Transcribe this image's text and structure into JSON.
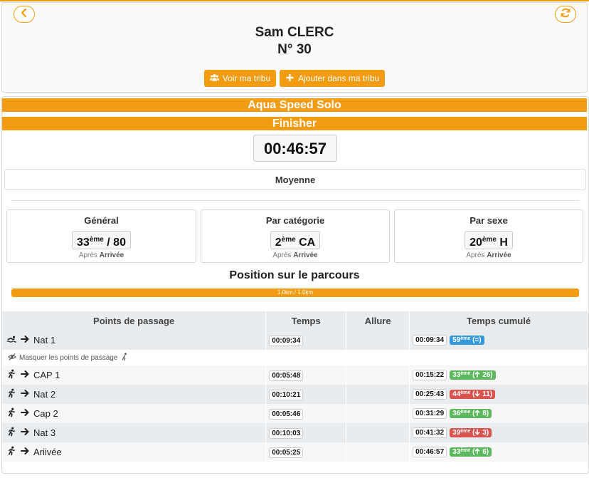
{
  "colors": {
    "accent": "#f39c12",
    "green": "#5cb85c",
    "red": "#d9534f",
    "blue": "#3498db"
  },
  "header": {
    "name": "Sam CLERC",
    "bib": "N° 30",
    "buttons": {
      "view_tribe": "Voir ma tribu",
      "add_tribe": "Ajouter dans ma tribu"
    },
    "icons": {
      "back": "chevron-left-icon",
      "refresh": "refresh-icon",
      "view_tribe": "users-icon",
      "add_tribe": "plus-icon"
    }
  },
  "race": {
    "name": "Aqua Speed Solo",
    "status": "Finisher",
    "total_time": "00:46:57",
    "average_label": "Moyenne"
  },
  "rankings": [
    {
      "title": "Général",
      "num": "33",
      "sup": "ème",
      "suffix": " / 80",
      "after_prefix": "Après",
      "after_point": "Arrivée"
    },
    {
      "title": "Par catégorie",
      "num": "2",
      "sup": "ème",
      "suffix": " CA",
      "after_prefix": "Après",
      "after_point": "Arrivée"
    },
    {
      "title": "Par sexe",
      "num": "20",
      "sup": "ème",
      "suffix": " H",
      "after_prefix": "Après",
      "after_point": "Arrivée"
    }
  ],
  "course": {
    "title": "Position sur le parcours",
    "progress_text": "1.0km / 1.0km",
    "progress_fraction": 1.0
  },
  "table": {
    "headers": [
      "Points de passage",
      "Temps",
      "Allure",
      "Temps cumulé"
    ],
    "hide_text": "Masquer les points de passage",
    "rows": [
      {
        "icon": "swim-icon",
        "label": "Nat 1",
        "time": "00:09:34",
        "cum": "00:09:34",
        "rank": "59",
        "sup": "ème",
        "delta": "(=)",
        "trend": "same",
        "color": "blue"
      },
      {
        "icon": "run-icon",
        "label": "CAP 1",
        "time": "00:05:48",
        "cum": "00:15:22",
        "rank": "33",
        "sup": "ème",
        "delta": "26)",
        "trend": "up",
        "color": "green"
      },
      {
        "icon": "run-icon",
        "label": "Nat 2",
        "time": "00:10:21",
        "cum": "00:25:43",
        "rank": "44",
        "sup": "ème",
        "delta": "11)",
        "trend": "down",
        "color": "red"
      },
      {
        "icon": "run-icon",
        "label": "Cap 2",
        "time": "00:05:46",
        "cum": "00:31:29",
        "rank": "36",
        "sup": "ème",
        "delta": "8)",
        "trend": "up",
        "color": "green"
      },
      {
        "icon": "run-icon",
        "label": "Nat 3",
        "time": "00:10:03",
        "cum": "00:41:32",
        "rank": "39",
        "sup": "ème",
        "delta": "3)",
        "trend": "down",
        "color": "red"
      },
      {
        "icon": "run-icon",
        "label": "Ariivée",
        "time": "00:05:25",
        "cum": "00:46:57",
        "rank": "33",
        "sup": "ème",
        "delta": "6)",
        "trend": "up",
        "color": "green"
      }
    ]
  }
}
